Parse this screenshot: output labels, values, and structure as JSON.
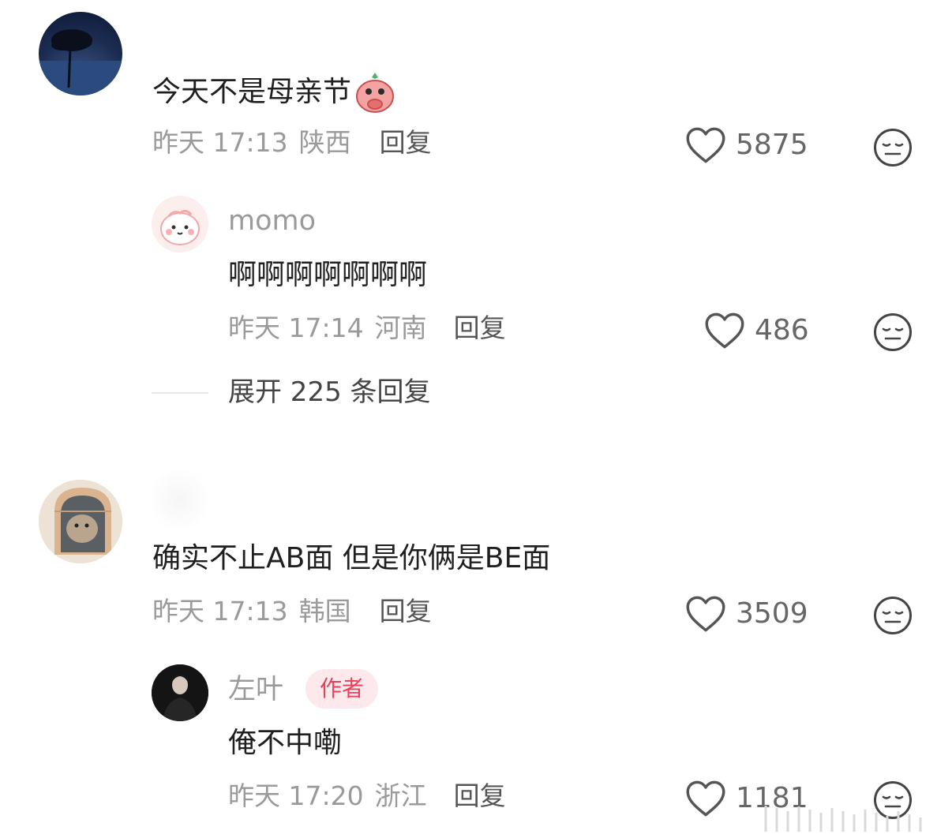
{
  "comments": [
    {
      "text": "今天不是母亲节",
      "emoji": "blush-emoji",
      "time": "昨天 17:13",
      "location": "陕西",
      "reply_label": "回复",
      "likes": "5875",
      "reply": {
        "username": "momo",
        "text": "啊啊啊啊啊啊啊",
        "time": "昨天 17:14",
        "location": "河南",
        "reply_label": "回复",
        "likes": "486"
      },
      "expand_label": "展开 225 条回复"
    },
    {
      "text": "确实不止AB面 但是你俩是BE面",
      "time": "昨天 17:13",
      "location": "韩国",
      "reply_label": "回复",
      "likes": "3509",
      "reply": {
        "username": "左叶",
        "badge": "作者",
        "text": "俺不中嘞",
        "time": "昨天 17:20",
        "location": "浙江",
        "reply_label": "回复",
        "likes": "1181"
      }
    }
  ],
  "colors": {
    "badge_bg": "#fde9ec",
    "badge_text": "#e8405a"
  }
}
